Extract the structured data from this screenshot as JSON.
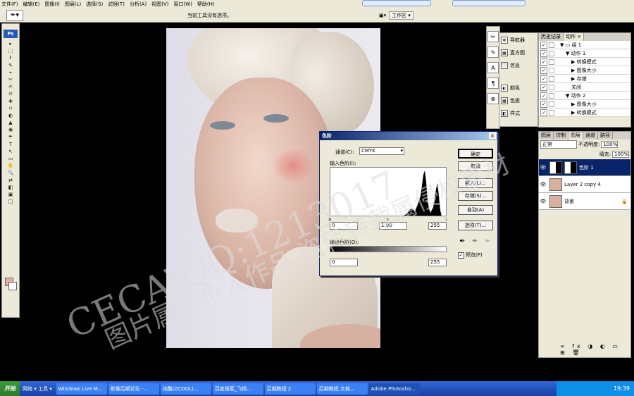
{
  "menubar": {
    "items": [
      "文件(F)",
      "编辑(E)",
      "图像(I)",
      "图层(L)",
      "选择(S)",
      "滤镜(T)",
      "分析(A)",
      "视图(V)",
      "窗口(W)",
      "帮助(H)"
    ]
  },
  "options_bar": {
    "message": "当前工具没有选项。",
    "workspace_label": "工作区 ▾"
  },
  "toolbox": {
    "logo": "Ps",
    "tools": [
      "▸",
      "⬚",
      "ℓ",
      "✎",
      "⌖",
      "✂",
      "✍",
      "⊙",
      "✚",
      "⌑",
      "◐",
      "▲",
      "◉",
      "✒",
      "T",
      "↖",
      "▭",
      "✋",
      "🔍",
      "⇄",
      "◧",
      "▣",
      "□"
    ]
  },
  "side_panel": {
    "items": [
      {
        "icon": "☸",
        "label": "导航器"
      },
      {
        "icon": "▦",
        "label": "直方图"
      },
      {
        "icon": "ⓘ",
        "label": "信息"
      },
      {
        "icon": "◐",
        "label": "颜色"
      },
      {
        "icon": "▦",
        "label": "色板"
      },
      {
        "icon": "◧",
        "label": "样式"
      }
    ]
  },
  "history_panel": {
    "tabs": [
      "历史记录",
      "动作 ×"
    ],
    "rows": [
      {
        "check": "✓",
        "indent": 6,
        "label": "▼ ▭ 组 1"
      },
      {
        "check": "✓",
        "indent": 14,
        "label": "▼ 动作 1"
      },
      {
        "check": "✓",
        "indent": 22,
        "label": "▶ 转换模式"
      },
      {
        "check": "✓",
        "indent": 22,
        "label": "▶ 图像大小"
      },
      {
        "check": "✓",
        "indent": 22,
        "label": "▶ 存储"
      },
      {
        "check": "✓",
        "indent": 22,
        "label": "关闭"
      },
      {
        "check": "✓",
        "indent": 14,
        "label": "▼ 动作 2"
      },
      {
        "check": "✓",
        "indent": 22,
        "label": "▶ 图像大小"
      },
      {
        "check": "✓",
        "indent": 22,
        "label": "▶ 转换模式"
      }
    ]
  },
  "layers_panel": {
    "tabs": [
      "图层",
      "仿制",
      "图层",
      "通道",
      "路径"
    ],
    "blend_mode": "正常",
    "opacity_label": "不透明度:",
    "opacity_value": "100%",
    "fill_label": "填充:",
    "fill_value": "100%",
    "layers": [
      {
        "name": "色阶 1",
        "selected": true,
        "thumb": "adjust"
      },
      {
        "name": "Layer 2 copy 4",
        "selected": false,
        "thumb": "photo"
      },
      {
        "name": "背景",
        "selected": false,
        "thumb": "photo",
        "lock": "🔒"
      }
    ],
    "footer_icons": "∞ fx ◑ ◐ ▭ ⊞ 🗑"
  },
  "levels_dialog": {
    "title": "色阶",
    "channel_label": "通道(C):",
    "channel_value": "CMYK",
    "input_label": "输入色阶(I):",
    "input_values": [
      "0",
      "1.00",
      "255"
    ],
    "output_label": "输出色阶(O):",
    "output_values": [
      "0",
      "255"
    ],
    "buttons": [
      "确定",
      "取消",
      "载入(L)...",
      "存储(S)...",
      "自动(A)",
      "选项(T)..."
    ],
    "preview_label": "预览(P)",
    "preview_checked": "✓"
  },
  "watermark": {
    "line1": "CECA\\QQ:1213017",
    "line2": "图片属于个人作品,盗转转载属侵权素材"
  },
  "taskbar": {
    "start": "开始",
    "quick": "网络 ▾  工具 ▾",
    "tasks": [
      "Windows Live M...",
      "影像后期论坛 -...",
      "站酷(ZCOOL)...",
      "百度搜索_飞扬...",
      "后期教程 2",
      "后期教程 文档...",
      "Adobe Photosho..."
    ],
    "clock": "19:39"
  }
}
